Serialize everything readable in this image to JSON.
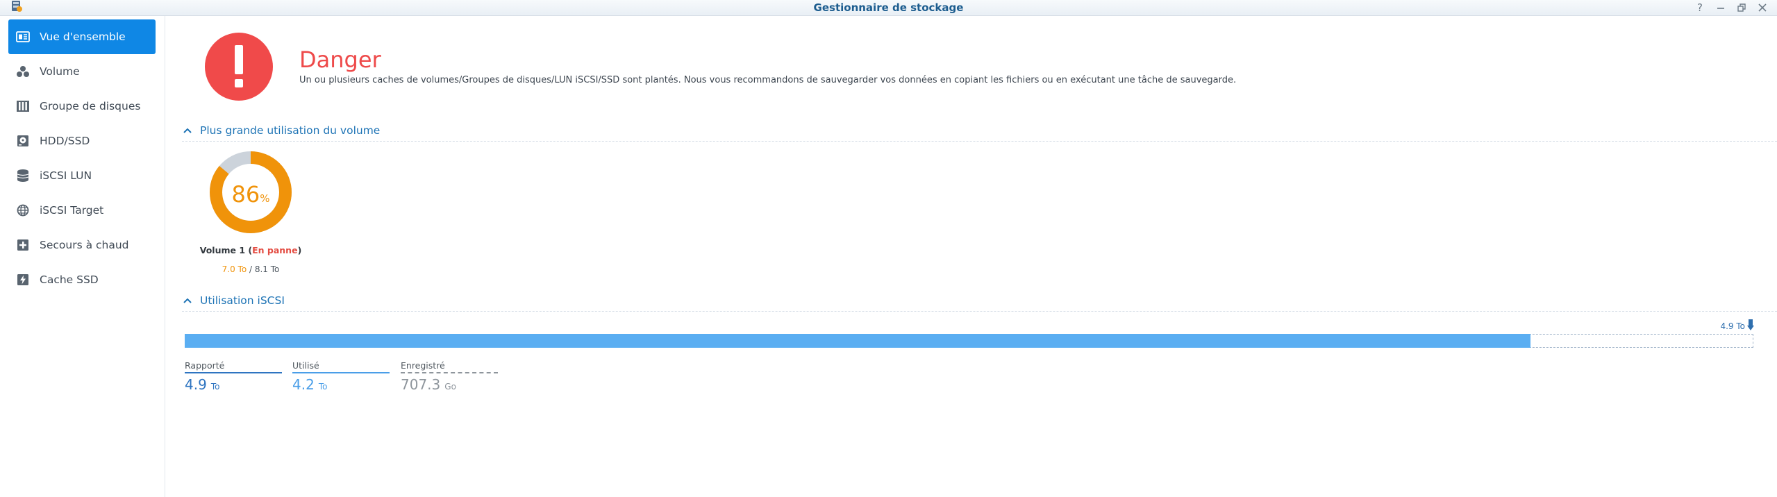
{
  "window": {
    "title": "Gestionnaire de stockage",
    "controls": [
      "help-icon",
      "minimize-icon",
      "restore-icon",
      "close-icon"
    ]
  },
  "sidebar": {
    "items": [
      {
        "label": "Vue d'ensemble",
        "icon": "overview-icon",
        "active": true
      },
      {
        "label": "Volume",
        "icon": "volume-icon",
        "active": false
      },
      {
        "label": "Groupe de disques",
        "icon": "disk-group-icon",
        "active": false
      },
      {
        "label": "HDD/SSD",
        "icon": "hdd-icon",
        "active": false
      },
      {
        "label": "iSCSI LUN",
        "icon": "lun-icon",
        "active": false
      },
      {
        "label": "iSCSI Target",
        "icon": "globe-icon",
        "active": false
      },
      {
        "label": "Secours à chaud",
        "icon": "hot-spare-icon",
        "active": false
      },
      {
        "label": "Cache SSD",
        "icon": "ssd-cache-icon",
        "active": false
      }
    ]
  },
  "status": {
    "title": "Danger",
    "description": "Un ou plusieurs caches de volumes/Groupes de disques/LUN iSCSI/SSD sont plantés. Nous vous recommandons de sauvegarder vos données en copiant les fichiers ou en exécutant une tâche de sauvegarde.",
    "icon": "exclamation-icon",
    "color": "#f04a4a"
  },
  "volume_usage": {
    "heading": "Plus grande utilisation du volume",
    "percent": "86",
    "percent_sign": "%",
    "percent_value": 86,
    "name": "Volume 1",
    "status": "En panne",
    "used": "7.0 To",
    "separator": " / ",
    "total": "8.1 To",
    "colors": {
      "used": "#f0930a",
      "free": "#ccd3db"
    }
  },
  "iscsi_usage": {
    "heading": "Utilisation iSCSI",
    "marker_label": "4.9 To",
    "fill_fraction": 0.858,
    "bar_color": "#5aaef2",
    "stats": [
      {
        "label": "Rapporté",
        "value": "4.9",
        "unit": "To",
        "color": "#2e74c1"
      },
      {
        "label": "Utilisé",
        "value": "4.2",
        "unit": "To",
        "color": "#4a9ee8"
      },
      {
        "label": "Enregistré",
        "value": "707.3",
        "unit": "Go",
        "color": "#8e959c"
      }
    ]
  }
}
